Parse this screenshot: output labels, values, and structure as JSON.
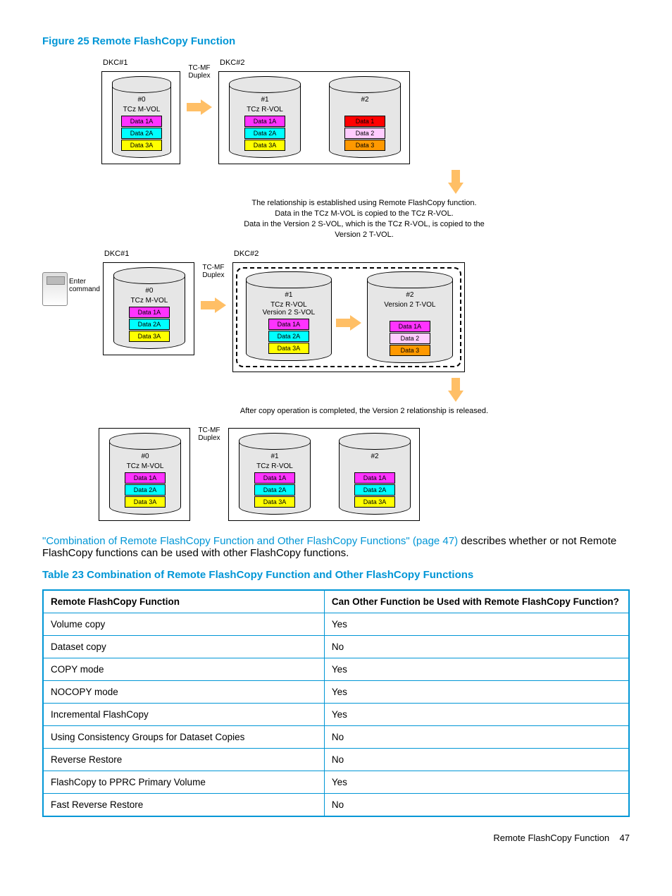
{
  "figure": {
    "title": "Figure 25 Remote FlashCopy Function",
    "dkc1": "DKC#1",
    "dkc2": "DKC#2",
    "tcmf_duplex": "TC-MF\nDuplex",
    "enter_command": "Enter\ncommand",
    "cyl0_num": "#0",
    "cyl0_role": "TCz M-VOL",
    "cyl1_num": "#1",
    "cyl1_role": "TCz R-VOL",
    "cyl2_num": "#2",
    "cyl1_role_b": "TCz R-VOL\nVersion 2 S-VOL",
    "cyl2_role_b": "Version 2 T-VOL",
    "d1a": "Data 1A",
    "d2a": "Data 2A",
    "d3a": "Data 3A",
    "d1": "Data 1",
    "d2": "Data 2",
    "d3": "Data 3",
    "desc1": "The relationship is established using Remote FlashCopy function.\nData in the TCz M-VOL is copied to the TCz R-VOL.\nData in the Version 2 S-VOL, which is the TCz R-VOL, is copied to the\nVersion 2 T-VOL.",
    "desc2": "After copy operation is completed, the Version 2 relationship is released."
  },
  "body": {
    "link": "\"Combination of Remote FlashCopy Function and Other FlashCopy Functions\" (page 47)",
    "rest": " describes whether or not Remote FlashCopy functions can be used with other FlashCopy functions."
  },
  "table": {
    "title": "Table 23 Combination of Remote FlashCopy Function and Other FlashCopy Functions",
    "h1": "Remote FlashCopy Function",
    "h2": "Can Other Function be Used with Remote FlashCopy Function?",
    "rows": [
      {
        "f": "Volume copy",
        "v": "Yes"
      },
      {
        "f": "Dataset copy",
        "v": "No"
      },
      {
        "f": "COPY mode",
        "v": "Yes"
      },
      {
        "f": "NOCOPY mode",
        "v": "Yes"
      },
      {
        "f": "Incremental FlashCopy",
        "v": "Yes"
      },
      {
        "f": "Using Consistency Groups for Dataset Copies",
        "v": "No"
      },
      {
        "f": "Reverse Restore",
        "v": "No"
      },
      {
        "f": "FlashCopy to PPRC Primary Volume",
        "v": "Yes"
      },
      {
        "f": "Fast Reverse Restore",
        "v": "No"
      }
    ]
  },
  "footer": {
    "section": "Remote FlashCopy Function",
    "page": "47"
  }
}
